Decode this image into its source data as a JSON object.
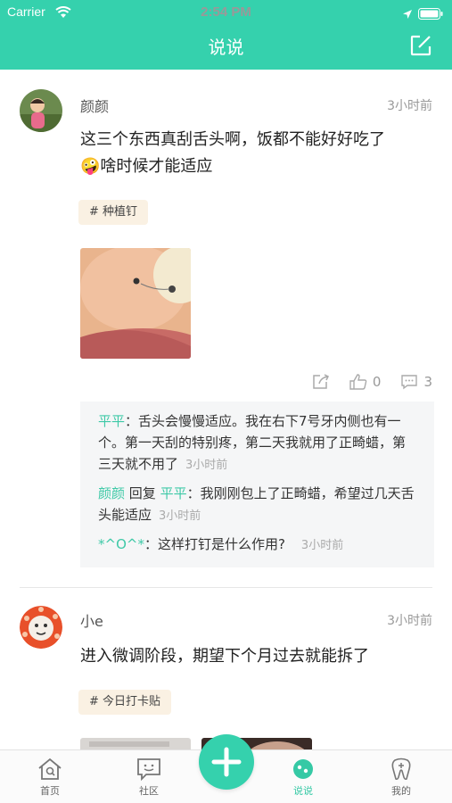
{
  "status_bar": {
    "carrier": "Carrier",
    "time": "2:54 PM"
  },
  "nav": {
    "title": "说说"
  },
  "colors": {
    "brand": "#35d1ad",
    "link": "#3ec9a7",
    "tag_bg": "#faf1e3"
  },
  "posts": [
    {
      "username": "颜颜",
      "time": "3小时前",
      "text_line1": "这三个东西真刮舌头啊，饭都不能好好吃了",
      "emoji": "🤪",
      "text_line2": "啥时候才能适应",
      "tag": "# 种植钉",
      "likes": "0",
      "comment_count": "3",
      "comments": [
        {
          "author": "平平",
          "text": "：舌头会慢慢适应。我在右下7号牙内侧也有一个。第一天刮的特别疼，第二天我就用了正畸蜡，第三天就不用了",
          "time": "3小时前"
        },
        {
          "author": "颜颜",
          "reply_word": " 回复 ",
          "reply_to": "平平",
          "text": "：我刚刚包上了正畸蜡，希望过几天舌头能适应",
          "time": "3小时前"
        },
        {
          "author": "*^O^*",
          "text": "：这样打钉是什么作用?",
          "time": "3小时前"
        }
      ]
    },
    {
      "username": "小e",
      "time": "3小时前",
      "text": "进入微调阶段，期望下个月过去就能拆了",
      "tag": "# 今日打卡贴"
    }
  ],
  "tabbar": {
    "home": "首页",
    "community": "社区",
    "shuoshuo": "说说",
    "mine": "我的"
  }
}
